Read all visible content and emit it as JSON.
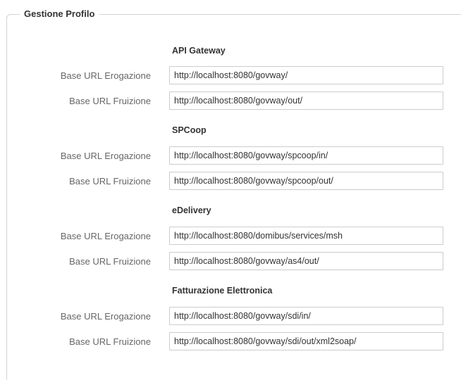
{
  "fieldset": {
    "legend": "Gestione Profilo"
  },
  "sections": [
    {
      "title": "API Gateway",
      "rows": [
        {
          "label": "Base URL Erogazione",
          "value": "http://localhost:8080/govway/"
        },
        {
          "label": "Base URL Fruizione",
          "value": "http://localhost:8080/govway/out/"
        }
      ]
    },
    {
      "title": "SPCoop",
      "rows": [
        {
          "label": "Base URL Erogazione",
          "value": "http://localhost:8080/govway/spcoop/in/"
        },
        {
          "label": "Base URL Fruizione",
          "value": "http://localhost:8080/govway/spcoop/out/"
        }
      ]
    },
    {
      "title": "eDelivery",
      "rows": [
        {
          "label": "Base URL Erogazione",
          "value": "http://localhost:8080/domibus/services/msh"
        },
        {
          "label": "Base URL Fruizione",
          "value": "http://localhost:8080/govway/as4/out/"
        }
      ]
    },
    {
      "title": "Fatturazione Elettronica",
      "rows": [
        {
          "label": "Base URL Erogazione",
          "value": "http://localhost:8080/govway/sdi/in/"
        },
        {
          "label": "Base URL Fruizione",
          "value": "http://localhost:8080/govway/sdi/out/xml2soap/"
        }
      ]
    }
  ]
}
